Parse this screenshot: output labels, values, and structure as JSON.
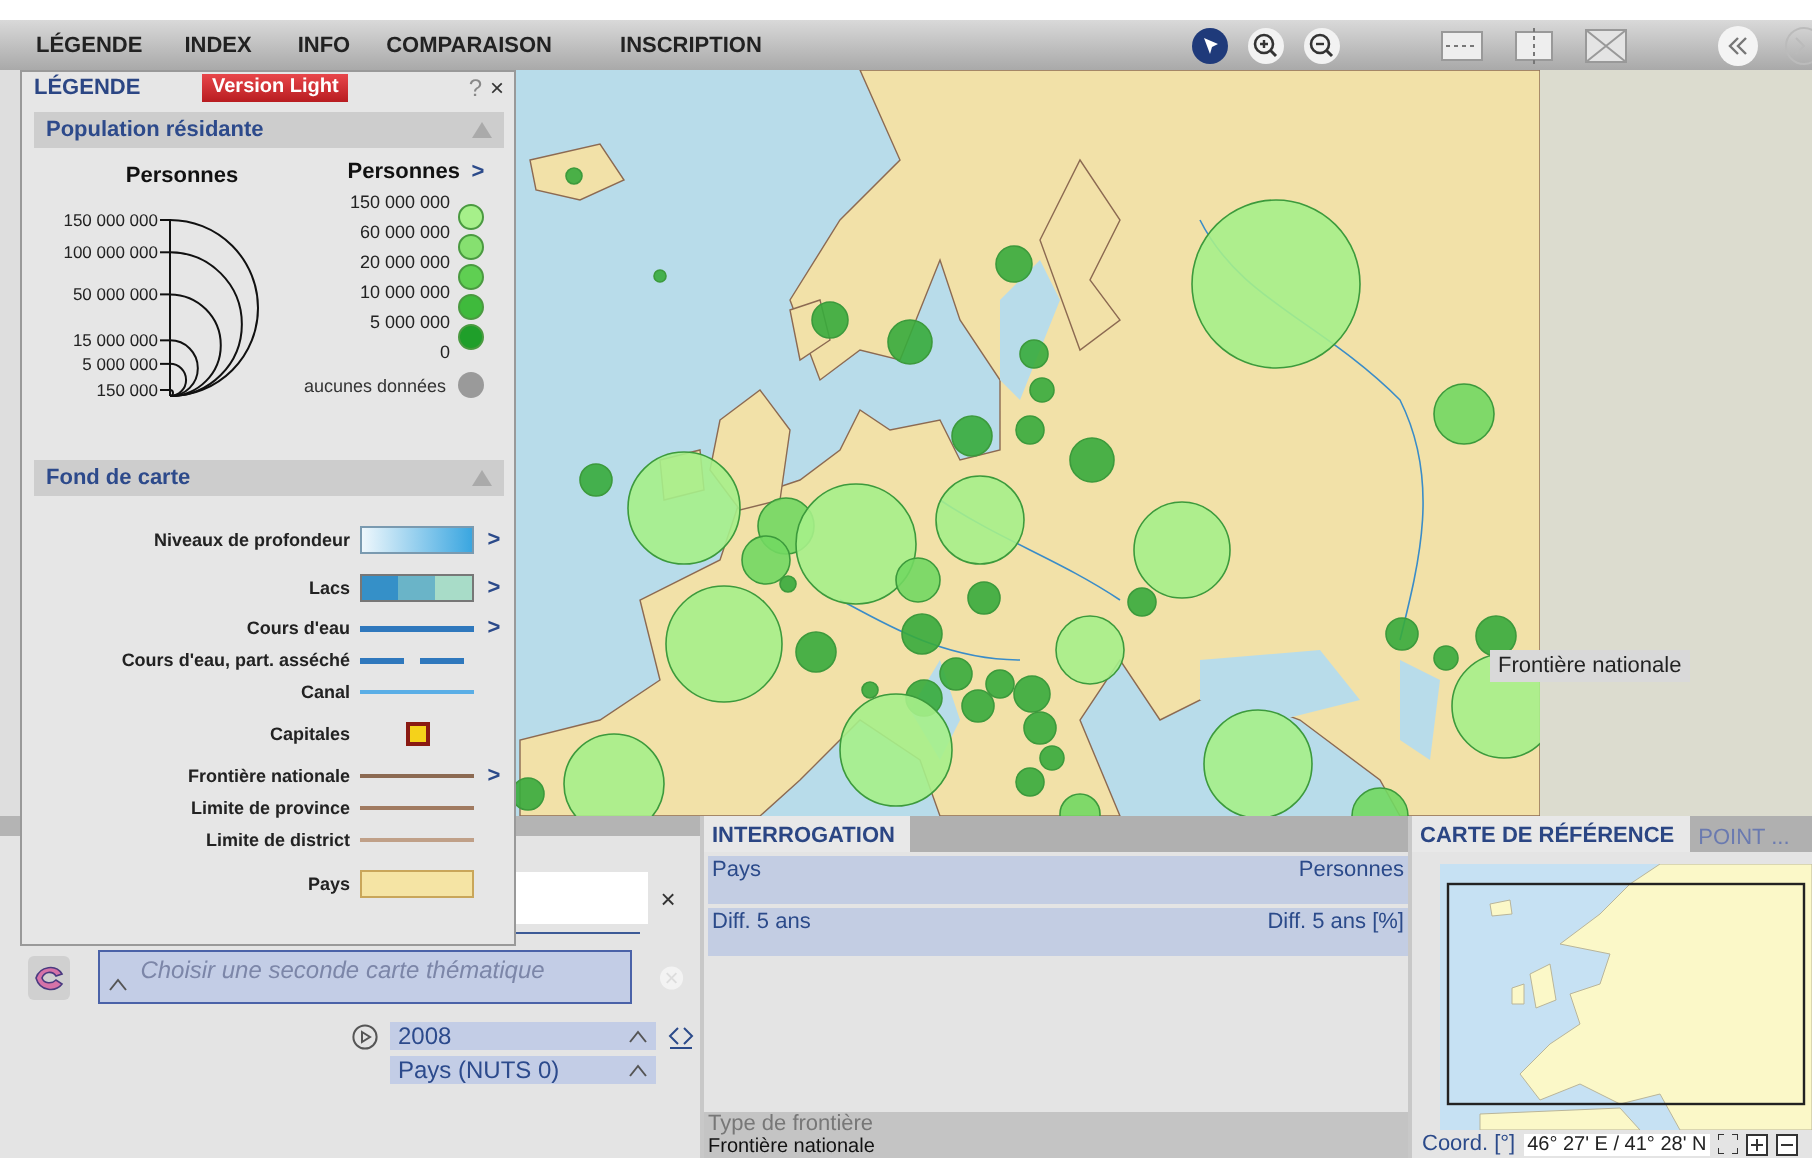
{
  "menu": [
    {
      "label": "LÉGENDE"
    },
    {
      "label": "INDEX"
    },
    {
      "label": "INFO"
    },
    {
      "label": "COMPARAISON"
    },
    {
      "label": "INSCRIPTION"
    }
  ],
  "tools": [
    {
      "kind": "pointer",
      "selected": true
    },
    {
      "kind": "zoom-in",
      "selected": false
    },
    {
      "kind": "zoom-out",
      "selected": false
    },
    {
      "kind": "split-horizontal",
      "selected": false
    },
    {
      "kind": "split-vertical",
      "selected": false
    },
    {
      "kind": "no-split",
      "selected": false
    }
  ],
  "legend": {
    "title": "LÉGENDE",
    "badge": "Version Light",
    "help": "?",
    "close": "×",
    "population": {
      "title": "Population résidante",
      "expanded": true,
      "size_heading": "Personnes",
      "sizes": [
        "150 000 000",
        "100 000 000",
        "50 000 000",
        "15 000 000",
        "5 000 000",
        "150 000"
      ],
      "color_heading": "Personnes",
      "color_more": ">",
      "limits": [
        "150 000 000",
        "60 000 000",
        "20 000 000",
        "10 000 000",
        "5 000 000",
        "0"
      ],
      "classes": [
        {
          "color": "#a6f08a"
        },
        {
          "color": "#86e070"
        },
        {
          "color": "#5fcf52"
        },
        {
          "color": "#3fba3c"
        },
        {
          "color": "#1f9f2a"
        }
      ],
      "no_data": {
        "label": "aucunes données",
        "color": "#9a9a9a"
      }
    },
    "basemap": {
      "title": "Fond de carte",
      "expanded": true,
      "items": [
        {
          "kind": "gradient",
          "label": "Niveaux de profondeur",
          "more": ">"
        },
        {
          "kind": "lakes",
          "label": "Lacs",
          "more": ">"
        },
        {
          "kind": "line",
          "label": "Cours d'eau",
          "color": "#2f78bd",
          "more": ">"
        },
        {
          "kind": "dashed",
          "label": "Cours d'eau, part. asséché",
          "color": "#2f78bd"
        },
        {
          "kind": "line",
          "label": "Canal",
          "color": "#5aaee6"
        },
        {
          "kind": "square",
          "label": "Capitales"
        },
        {
          "kind": "line",
          "label": "Frontière nationale",
          "color": "#8c6a52",
          "more": ">"
        },
        {
          "kind": "line",
          "label": "Limite de province",
          "color": "#a07a60"
        },
        {
          "kind": "line",
          "label": "Limite de district",
          "color": "#c0a088"
        },
        {
          "kind": "fill",
          "label": "Pays"
        }
      ]
    }
  },
  "map": {
    "tooltip": "Frontière nationale"
  },
  "controls": {
    "clear": "×",
    "second_map": {
      "placeholder": "Choisir une seconde carte thématique"
    },
    "year": "2008",
    "level": "Pays (NUTS 0)"
  },
  "interrogation": {
    "tab": "INTERROGATION",
    "rows": [
      {
        "label": "Pays",
        "unit": "Personnes"
      },
      {
        "label": "Diff. 5 ans",
        "unit": "Diff. 5 ans [%]"
      }
    ],
    "footer": {
      "label": "Type de frontière",
      "value": "Frontière nationale"
    }
  },
  "reference": {
    "tabs": [
      {
        "label": "CARTE DE RÉFÉRENCE",
        "selected": true
      },
      {
        "label": "POINT ...",
        "selected": false
      }
    ],
    "coord_label": "Coord. [°]",
    "coord_value": "46° 27' E / 41° 28' N"
  }
}
